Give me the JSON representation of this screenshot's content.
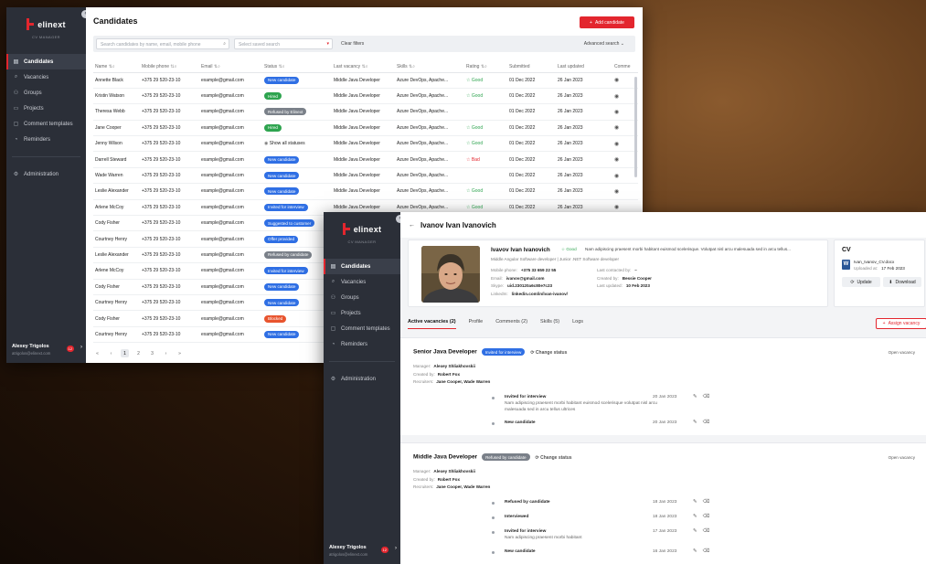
{
  "app": {
    "logo_text": "elinext",
    "logo_sub": "CV MANAGER",
    "nav": [
      {
        "label": "Candidates",
        "icon": "users-icon",
        "active": true
      },
      {
        "label": "Vacancies",
        "icon": "search-icon"
      },
      {
        "label": "Groups",
        "icon": "group-icon"
      },
      {
        "label": "Projects",
        "icon": "folder-icon"
      },
      {
        "label": "Comment templates",
        "icon": "comment-icon"
      },
      {
        "label": "Reminders",
        "icon": "bell-icon"
      }
    ],
    "admin_label": "Administration",
    "user": {
      "name": "Alexey Trigolos",
      "email": "atrigolos@elinext.com",
      "badge": "12"
    }
  },
  "list": {
    "title": "Candidates",
    "add_button": "Add candidate",
    "search_placeholder": "Search candidates by name, email, mobile phone",
    "saved_search_placeholder": "Select saved search",
    "clear_filters": "Clear filters",
    "advanced_search": "Advanced search",
    "columns": [
      "Name",
      "Mobile phone",
      "Email",
      "Status",
      "Last vacancy",
      "Skills",
      "Rating",
      "Submitted",
      "Last updated",
      "Comme"
    ],
    "rows": [
      {
        "name": "Annette Black",
        "phone": "+375 29 520-23-10",
        "email": "example@gmail.com",
        "status": "New candidate",
        "status_color": "#2f6fe4",
        "vacancy": "Middle Java Developer",
        "skills": "Azure DevOps, Apache...",
        "rating": "Good",
        "submitted": "01 Dec 2022",
        "updated": "26 Jan 2023"
      },
      {
        "name": "Kristin Watson",
        "phone": "+375 29 520-23-10",
        "email": "example@gmail.com",
        "status": "Hired",
        "status_color": "#2ea44f",
        "vacancy": "Middle Java Developer",
        "skills": "Azure DevOps, Apache...",
        "rating": "Good",
        "submitted": "01 Dec 2022",
        "updated": "26 Jan 2023"
      },
      {
        "name": "Theresa Webb",
        "phone": "+375 29 520-23-10",
        "email": "example@gmail.com",
        "status": "Refused by Elinext",
        "status_color": "#7a8089",
        "vacancy": "Middle Java Developer",
        "skills": "Azure DevOps, Apache...",
        "rating": "",
        "submitted": "01 Dec 2022",
        "updated": "26 Jan 2023"
      },
      {
        "name": "Jane Cooper",
        "phone": "+375 29 520-23-10",
        "email": "example@gmail.com",
        "status": "Hired",
        "status_color": "#2ea44f",
        "vacancy": "Middle Java Developer",
        "skills": "Azure DevOps, Apache...",
        "rating": "Good",
        "submitted": "01 Dec 2022",
        "updated": "26 Jan 2023"
      },
      {
        "name": "Jenny Wilson",
        "phone": "+375 29 520-23-10",
        "email": "example@gmail.com",
        "status": "Show all statuses",
        "status_color": "",
        "vacancy": "Middle Java Developer",
        "skills": "Azure DevOps, Apache...",
        "rating": "Good",
        "submitted": "01 Dec 2022",
        "updated": "26 Jan 2023"
      },
      {
        "name": "Darrell Steward",
        "phone": "+375 29 520-23-10",
        "email": "example@gmail.com",
        "status": "New candidate",
        "status_color": "#2f6fe4",
        "vacancy": "Middle Java Developer",
        "skills": "Azure DevOps, Apache...",
        "rating": "Bad",
        "submitted": "01 Dec 2022",
        "updated": "26 Jan 2023"
      },
      {
        "name": "Wade Warren",
        "phone": "+375 29 520-23-10",
        "email": "example@gmail.com",
        "status": "New candidate",
        "status_color": "#2f6fe4",
        "vacancy": "Middle Java Developer",
        "skills": "Azure DevOps, Apache...",
        "rating": "",
        "submitted": "01 Dec 2022",
        "updated": "26 Jan 2023"
      },
      {
        "name": "Leslie Alexander",
        "phone": "+375 29 520-23-10",
        "email": "example@gmail.com",
        "status": "New candidate",
        "status_color": "#2f6fe4",
        "vacancy": "Middle Java Developer",
        "skills": "Azure DevOps, Apache...",
        "rating": "Good",
        "submitted": "01 Dec 2022",
        "updated": "26 Jan 2023"
      },
      {
        "name": "Arlene McCoy",
        "phone": "+375 29 520-23-10",
        "email": "example@gmail.com",
        "status": "Invited for interview",
        "status_color": "#2f6fe4",
        "vacancy": "Middle Java Developer",
        "skills": "Azure DevOps, Apache...",
        "rating": "Good",
        "submitted": "01 Dec 2022",
        "updated": "26 Jan 2023"
      },
      {
        "name": "Cody Fisher",
        "phone": "+375 29 520-23-10",
        "email": "example@gmail.com",
        "status": "Suggested to customer",
        "status_color": "#2f6fe4",
        "vacancy": "",
        "skills": "",
        "rating": "",
        "submitted": "",
        "updated": ""
      },
      {
        "name": "Courtney Henry",
        "phone": "+375 29 520-23-10",
        "email": "example@gmail.com",
        "status": "Offer provided",
        "status_color": "#2f6fe4",
        "vacancy": "",
        "skills": "",
        "rating": "",
        "submitted": "",
        "updated": ""
      },
      {
        "name": "Leslie Alexander",
        "phone": "+375 29 520-23-10",
        "email": "example@gmail.com",
        "status": "Refused by candidate",
        "status_color": "#7a8089",
        "vacancy": "",
        "skills": "",
        "rating": "",
        "submitted": "",
        "updated": ""
      },
      {
        "name": "Arlene McCoy",
        "phone": "+375 29 520-23-10",
        "email": "example@gmail.com",
        "status": "Invited for interview",
        "status_color": "#2f6fe4",
        "vacancy": "",
        "skills": "",
        "rating": "",
        "submitted": "",
        "updated": ""
      },
      {
        "name": "Cody Fisher",
        "phone": "+375 29 520-23-10",
        "email": "example@gmail.com",
        "status": "New candidate",
        "status_color": "#2f6fe4",
        "vacancy": "",
        "skills": "",
        "rating": "",
        "submitted": "",
        "updated": ""
      },
      {
        "name": "Courtney Henry",
        "phone": "+375 29 520-23-10",
        "email": "example@gmail.com",
        "status": "New candidate",
        "status_color": "#2f6fe4",
        "vacancy": "",
        "skills": "",
        "rating": "",
        "submitted": "",
        "updated": ""
      },
      {
        "name": "Cody Fisher",
        "phone": "+375 29 520-23-10",
        "email": "example@gmail.com",
        "status": "Blocked",
        "status_color": "#e8542e",
        "vacancy": "",
        "skills": "",
        "rating": "",
        "submitted": "",
        "updated": ""
      },
      {
        "name": "Courtney Henry",
        "phone": "+375 29 520-23-10",
        "email": "example@gmail.com",
        "status": "New candidate",
        "status_color": "#2f6fe4",
        "vacancy": "",
        "skills": "",
        "rating": "",
        "submitted": "",
        "updated": ""
      }
    ],
    "pager": [
      "«",
      "‹",
      "1",
      "2",
      "3",
      "›",
      "»"
    ]
  },
  "detail": {
    "title": "Ivanov Ivan Ivanovich",
    "name": "Ivavov Ivan Ivanovich",
    "rating": "Good",
    "summary": "Nam adipiscing praesent morbi habitant euismod scelerisque. Volutpat nisl arcu malesuada sed in arcu tellus...",
    "position": "Middle Angular Software developer | Junior .NET Software developer",
    "fields_left": [
      {
        "k": "Mobile phone:",
        "v": "+375 33 659 22 55"
      },
      {
        "k": "Email:",
        "v": "ivanov@gmail.com"
      },
      {
        "k": "Skype:",
        "v": "uid.230120a6c80e7c23"
      },
      {
        "k": "LinkedIn:",
        "v": "linkedin.com/in/ivan-ivanov/"
      }
    ],
    "fields_right": [
      {
        "k": "Last contacted by:",
        "v": "–"
      },
      {
        "k": "Created by:",
        "v": "Bessie Cooper"
      },
      {
        "k": "Last updated:",
        "v": "10 Feb 2023"
      }
    ],
    "cv": {
      "title": "CV",
      "file": "Ivan_Ivanov_CV.docx",
      "uploaded_label": "Uploaded at:",
      "uploaded": "17 Feb 2023",
      "update": "Update",
      "download": "Download"
    },
    "tabs": [
      "Active vacancies (2)",
      "Profile",
      "Comments (2)",
      "Skills (5)",
      "Logs"
    ],
    "assign_button": "Assign vacancy",
    "vacancies": [
      {
        "title": "Senior Java Developer",
        "status": "Invited for interview",
        "status_color": "#2f6fe4",
        "change_status": "Change status",
        "open": "Open vacancy",
        "manager": "Alexey Shliakhovskii",
        "created_by": "Robert Fox",
        "recruiters": "Jane Cooper, Wade Warren",
        "timeline": [
          {
            "label": "Invited for interview",
            "sub": "Nam adipiscing praesent morbi habitant euismod scelerisque volutpat nisl arcu malesuada sed in arcu tellus ultrices",
            "date": "20 Jan 2023"
          },
          {
            "label": "New candidate",
            "sub": "",
            "date": "20 Jan 2023"
          }
        ]
      },
      {
        "title": "Middle Java Developer",
        "status": "Refused by candidate",
        "status_color": "#7a8089",
        "change_status": "Change status",
        "open": "Open vacancy",
        "manager": "Alexey Shliakhovskii",
        "created_by": "Robert Fox",
        "recruiters": "Jane Cooper, Wade Warren",
        "timeline": [
          {
            "label": "Refused by candidate",
            "sub": "",
            "date": "18 Jan 2023"
          },
          {
            "label": "Interviewed",
            "sub": "",
            "date": "18 Jan 2023"
          },
          {
            "label": "Invited for interview",
            "sub": "Nam adipiscing praesent morbi habitant",
            "date": "17 Jan 2023"
          },
          {
            "label": "New candidate",
            "sub": "",
            "date": "16 Jan 2023"
          }
        ]
      }
    ],
    "labels": {
      "manager": "Manager:",
      "created_by": "Created by:",
      "recruiters": "Recruiters:"
    }
  },
  "colors": {
    "accent": "#e3262e",
    "sidebar": "#2b2f38",
    "good": "#2ea44f",
    "new": "#2f6fe4"
  }
}
